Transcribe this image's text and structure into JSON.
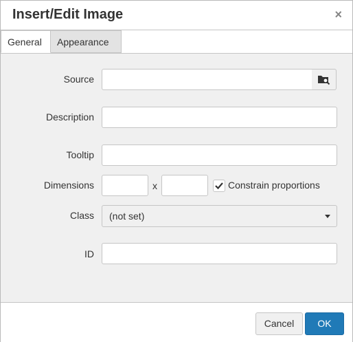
{
  "dialog": {
    "title": "Insert/Edit Image",
    "close_symbol": "×"
  },
  "tabs": [
    {
      "label": "General",
      "active": true
    },
    {
      "label": "Appearance",
      "active": false
    }
  ],
  "form": {
    "source_label": "Source",
    "source_value": "",
    "browse_icon": "folder-search-icon",
    "description_label": "Description",
    "description_value": "",
    "tooltip_label": "Tooltip",
    "tooltip_value": "",
    "dimensions_label": "Dimensions",
    "width_value": "",
    "height_value": "",
    "dimensions_separator": "x",
    "constrain_label": "Constrain proportions",
    "constrain_checked": true,
    "class_label": "Class",
    "class_value": "(not set)",
    "id_label": "ID",
    "id_value": ""
  },
  "footer": {
    "cancel_label": "Cancel",
    "ok_label": "OK"
  },
  "colors": {
    "primary_button": "#207ab7",
    "panel_bg": "#f0f0f0"
  }
}
